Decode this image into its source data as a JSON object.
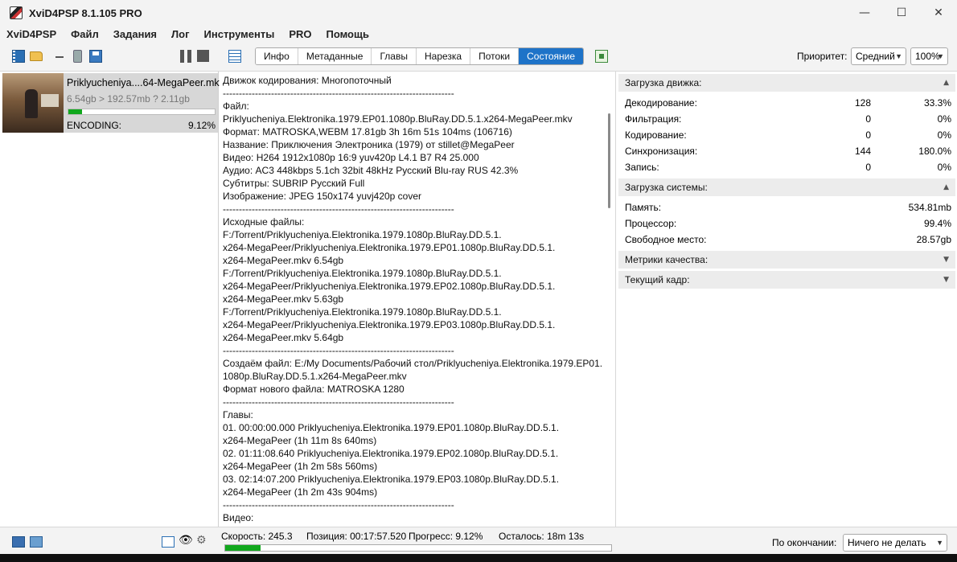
{
  "window": {
    "title": "XviD4PSP 8.1.105 PRO",
    "minimize": "—",
    "maximize": "☐",
    "close": "✕"
  },
  "menu": [
    "XviD4PSP",
    "Файл",
    "Задания",
    "Лог",
    "Инструменты",
    "PRO",
    "Помощь"
  ],
  "toolbar": {
    "tabs": [
      "Инфо",
      "Метаданные",
      "Главы",
      "Нарезка",
      "Потоки",
      "Состояние"
    ],
    "active_tab": "Состояние",
    "priority_label": "Приоритет:",
    "priority_value": "Средний",
    "zoom_value": "100%"
  },
  "job": {
    "name": "Priklyucheniya....64-MegaPeer.mkv",
    "size": "6.54gb > 192.57mb ? 2.11gb",
    "progress": 0.0912,
    "status": "ENCODING:",
    "percent": "9.12%"
  },
  "info": {
    "lines": [
      "Движок кодирования: Многопоточный",
      "------------------------------------------------------------------------",
      "Файл:",
      "Priklyucheniya.Elektronika.1979.EP01.1080p.BluRay.DD.5.1.x264-MegaPeer.mkv",
      "Формат: MATROSKA,WEBM 17.81gb 3h 16m 51s 104ms (106716)",
      "Название: Приключения Электроника (1979) от stillet@MegaPeer",
      "Видео: H264 1912x1080p 16:9 yuv420p L4.1 B7 R4 25.000",
      "Аудио: AC3 448kbps 5.1ch 32bit 48kHz Русский Blu-ray RUS 42.3%",
      "Субтитры: SUBRIP Русский Full",
      "Изображение: JPEG 150x174 yuvj420p cover",
      "------------------------------------------------------------------------",
      "Исходные файлы:",
      "F:/Torrent/Priklyucheniya.Elektronika.1979.1080p.BluRay.DD.5.1.",
      "x264-MegaPeer/Priklyucheniya.Elektronika.1979.EP01.1080p.BluRay.DD.5.1.",
      "x264-MegaPeer.mkv 6.54gb",
      "F:/Torrent/Priklyucheniya.Elektronika.1979.1080p.BluRay.DD.5.1.",
      "x264-MegaPeer/Priklyucheniya.Elektronika.1979.EP02.1080p.BluRay.DD.5.1.",
      "x264-MegaPeer.mkv 5.63gb",
      "F:/Torrent/Priklyucheniya.Elektronika.1979.1080p.BluRay.DD.5.1.",
      "x264-MegaPeer/Priklyucheniya.Elektronika.1979.EP03.1080p.BluRay.DD.5.1.",
      "x264-MegaPeer.mkv 5.64gb",
      "------------------------------------------------------------------------",
      "Создаём файл: E:/My Documents/Рабочий стол/Priklyucheniya.Elektronika.1979.EP01.",
      "1080p.BluRay.DD.5.1.x264-MegaPeer.mkv",
      "Формат нового файла: MATROSKA 1280",
      "------------------------------------------------------------------------",
      "Главы:",
      "01. 00:00:00.000 Priklyucheniya.Elektronika.1979.EP01.1080p.BluRay.DD.5.1.",
      "x264-MegaPeer (1h 11m 8s 640ms)",
      "02. 01:11:08.640 Priklyucheniya.Elektronika.1979.EP02.1080p.BluRay.DD.5.1.",
      "x264-MegaPeer (1h 2m 58s 560ms)",
      "03. 02:14:07.200 Priklyucheniya.Elektronika.1979.EP03.1080p.BluRay.DD.5.1.",
      "x264-MegaPeer (1h 2m 43s 904ms)",
      "------------------------------------------------------------------------",
      "Видео:"
    ]
  },
  "stats": {
    "engine_load": {
      "title": "Загрузка движка:",
      "rows": [
        {
          "label": "Декодирование:",
          "count": "128",
          "pct": "33.3%"
        },
        {
          "label": "Фильтрация:",
          "count": "0",
          "pct": "0%"
        },
        {
          "label": "Кодирование:",
          "count": "0",
          "pct": "0%"
        },
        {
          "label": "Синхронизация:",
          "count": "144",
          "pct": "180.0%"
        },
        {
          "label": "Запись:",
          "count": "0",
          "pct": "0%"
        }
      ]
    },
    "system_load": {
      "title": "Загрузка системы:",
      "rows": [
        {
          "label": "Память:",
          "value": "534.81mb"
        },
        {
          "label": "Процессор:",
          "value": "99.4%"
        },
        {
          "label": "Свободное место:",
          "value": "28.57gb"
        }
      ]
    },
    "quality_metrics": {
      "title": "Метрики качества:"
    },
    "current_frame": {
      "title": "Текущий кадр:"
    }
  },
  "statusbar": {
    "speed": "Скорость: 245.3",
    "position": "Позиция: 00:17:57.520",
    "progress_text": "Прогресс: 9.12%",
    "remaining": "Осталось: 18m 13s",
    "progress": 0.0912,
    "on_finish_label": "По окончании:",
    "on_finish_value": "Ничего не делать"
  },
  "colors": {
    "accent": "#1e73c8",
    "progress": "#11a81d"
  }
}
